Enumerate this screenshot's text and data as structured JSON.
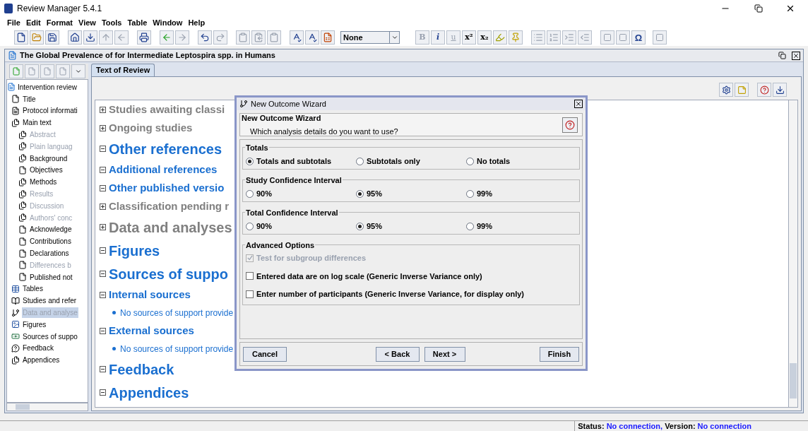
{
  "window": {
    "title": "Review Manager 5.4.1"
  },
  "menu": [
    "File",
    "Edit",
    "Format",
    "View",
    "Tools",
    "Table",
    "Window",
    "Help"
  ],
  "toolbar": {
    "style_select": "None",
    "format_buttons": [
      {
        "label": "B",
        "kind": "bold"
      },
      {
        "label": "i",
        "kind": "italic"
      },
      {
        "label": "u",
        "kind": "underline"
      },
      {
        "label": "x²",
        "kind": "plain"
      },
      {
        "label": "x₂",
        "kind": "plain"
      }
    ],
    "symbol_button": "Ω"
  },
  "document": {
    "title": "The Global Prevalence of for Intermediate Leptospira spp. in Humans"
  },
  "tree": {
    "root": "Intervention review",
    "children": [
      {
        "label": "Title",
        "kind": "page",
        "dimmed": false,
        "selected": false
      },
      {
        "label": "Protocol informati",
        "kind": "form",
        "dimmed": false,
        "selected": false
      },
      {
        "label": "Main text",
        "kind": "pages",
        "dimmed": false,
        "selected": false,
        "children": [
          {
            "label": "Abstract",
            "kind": "pages",
            "dimmed": true,
            "selected": false
          },
          {
            "label": "Plain languag",
            "kind": "pages",
            "dimmed": true,
            "selected": false
          },
          {
            "label": "Background",
            "kind": "pages",
            "dimmed": false,
            "selected": false
          },
          {
            "label": "Objectives",
            "kind": "page",
            "dimmed": false,
            "selected": false
          },
          {
            "label": "Methods",
            "kind": "pages",
            "dimmed": false,
            "selected": false
          },
          {
            "label": "Results",
            "kind": "pages",
            "dimmed": true,
            "selected": false
          },
          {
            "label": "Discussion",
            "kind": "pages",
            "dimmed": true,
            "selected": false
          },
          {
            "label": "Authors' conc",
            "kind": "pages",
            "dimmed": true,
            "selected": false
          },
          {
            "label": "Acknowledge",
            "kind": "page",
            "dimmed": false,
            "selected": false
          },
          {
            "label": "Contributions",
            "kind": "page",
            "dimmed": false,
            "selected": false
          },
          {
            "label": "Declarations",
            "kind": "page",
            "dimmed": false,
            "selected": false
          },
          {
            "label": "Differences b",
            "kind": "page",
            "dimmed": true,
            "selected": false
          },
          {
            "label": "Published not",
            "kind": "page",
            "dimmed": false,
            "selected": false
          }
        ]
      },
      {
        "label": "Tables",
        "kind": "table",
        "dimmed": false,
        "selected": false
      },
      {
        "label": "Studies and refer",
        "kind": "book",
        "dimmed": false,
        "selected": false
      },
      {
        "label": "Data and analyse",
        "kind": "forest",
        "dimmed": false,
        "selected": true
      },
      {
        "label": "Figures",
        "kind": "image",
        "dimmed": false,
        "selected": false
      },
      {
        "label": "Sources of suppo",
        "kind": "money",
        "dimmed": false,
        "selected": false
      },
      {
        "label": "Feedback",
        "kind": "feedback",
        "dimmed": false,
        "selected": false
      },
      {
        "label": "Appendices",
        "kind": "pages",
        "dimmed": false,
        "selected": false
      }
    ]
  },
  "tabs": [
    {
      "label": "Text of Review",
      "selected": true
    }
  ],
  "content": [
    {
      "kind": "subsection",
      "text": "Studies awaiting classi",
      "expanded": false,
      "dimmed": true
    },
    {
      "kind": "subsection",
      "text": "Ongoing studies",
      "expanded": false,
      "dimmed": true
    },
    {
      "kind": "section",
      "text": "Other references",
      "expanded": true,
      "dimmed": false
    },
    {
      "kind": "subsection",
      "text": "Additional references",
      "expanded": true,
      "dimmed": false
    },
    {
      "kind": "subsection",
      "text": "Other published versio",
      "expanded": true,
      "dimmed": false
    },
    {
      "kind": "subsection",
      "text": "Classification pending r",
      "expanded": false,
      "dimmed": true
    },
    {
      "kind": "section",
      "text": "Data and analyses",
      "expanded": false,
      "dimmed": true
    },
    {
      "kind": "section",
      "text": "Figures",
      "expanded": true,
      "dimmed": false
    },
    {
      "kind": "section",
      "text": "Sources of suppo",
      "expanded": true,
      "dimmed": false
    },
    {
      "kind": "subsection",
      "text": "Internal sources",
      "expanded": true,
      "dimmed": false
    },
    {
      "kind": "bullet",
      "text": "No sources of support provide",
      "dimmed": false
    },
    {
      "kind": "subsection",
      "text": "External sources",
      "expanded": true,
      "dimmed": false
    },
    {
      "kind": "bullet",
      "text": "No sources of support provide",
      "dimmed": false
    },
    {
      "kind": "section",
      "text": "Feedback",
      "expanded": true,
      "dimmed": false
    },
    {
      "kind": "section",
      "text": "Appendices",
      "expanded": true,
      "dimmed": false
    }
  ],
  "dialog": {
    "title": "New Outcome Wizard",
    "heading": "New Outcome Wizard",
    "question": "Which analysis details do you want to use?",
    "groups": [
      {
        "title": "Totals",
        "options": [
          {
            "label": "Totals and subtotals",
            "selected": true
          },
          {
            "label": "Subtotals only",
            "selected": false
          },
          {
            "label": "No totals",
            "selected": false
          }
        ]
      },
      {
        "title": "Study Confidence Interval",
        "options": [
          {
            "label": "90%",
            "selected": false
          },
          {
            "label": "95%",
            "selected": true
          },
          {
            "label": "99%",
            "selected": false
          }
        ]
      },
      {
        "title": "Total Confidence Interval",
        "options": [
          {
            "label": "90%",
            "selected": false
          },
          {
            "label": "95%",
            "selected": true
          },
          {
            "label": "99%",
            "selected": false
          }
        ]
      }
    ],
    "advanced": {
      "title": "Advanced Options",
      "options": [
        {
          "label": "Test for subgroup differences",
          "checked": true,
          "disabled": true
        },
        {
          "label": "Entered data are on log scale (Generic Inverse Variance only)",
          "checked": false,
          "disabled": false
        },
        {
          "label": "Enter number of participants (Generic Inverse Variance, for display only)",
          "checked": false,
          "disabled": false
        }
      ]
    },
    "buttons": {
      "cancel": "Cancel",
      "back": "< Back",
      "next": "Next >",
      "finish": "Finish"
    }
  },
  "status_bar": {
    "status_label": "Status:",
    "status_value": "No connection,",
    "version_label": "Version:",
    "version_value": "No connection"
  }
}
